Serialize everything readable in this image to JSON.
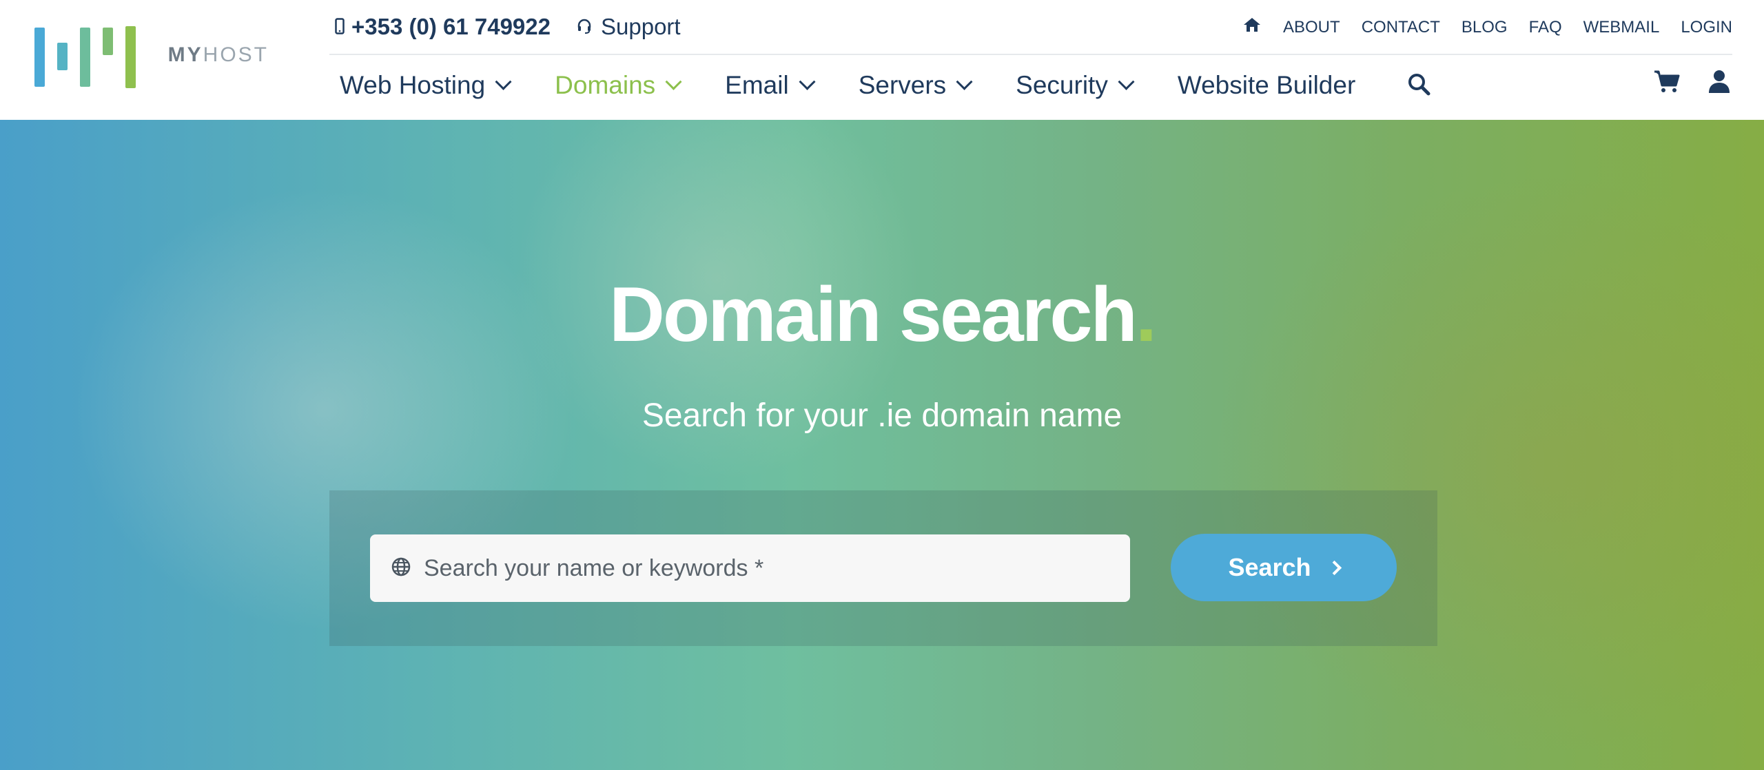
{
  "brand": {
    "name_primary": "MY",
    "name_secondary": "HOST",
    "bar_colors": [
      "#4aa9d6",
      "#55b3c4",
      "#6dbd9c",
      "#7ebd73",
      "#8fc04e"
    ]
  },
  "topbar": {
    "phone": "+353 (0) 61 749922",
    "support": "Support",
    "links": [
      "ABOUT",
      "CONTACT",
      "BLOG",
      "FAQ",
      "WEBMAIL",
      "LOGIN"
    ]
  },
  "nav": {
    "items": [
      {
        "label": "Web Hosting",
        "has_dropdown": true
      },
      {
        "label": "Domains",
        "has_dropdown": true
      },
      {
        "label": "Email",
        "has_dropdown": true
      },
      {
        "label": "Servers",
        "has_dropdown": true
      },
      {
        "label": "Security",
        "has_dropdown": true
      },
      {
        "label": "Website Builder",
        "has_dropdown": false
      }
    ],
    "active": "Domains"
  },
  "hero": {
    "title": "Domain search",
    "title_dot": ".",
    "subtitle": "Search for your .ie domain name",
    "search_placeholder": "Search your name or keywords *",
    "search_button": "Search"
  },
  "colors": {
    "brand_dark": "#1f3a5c",
    "accent_green": "#8cc04c",
    "button_blue": "#4eaad8"
  }
}
